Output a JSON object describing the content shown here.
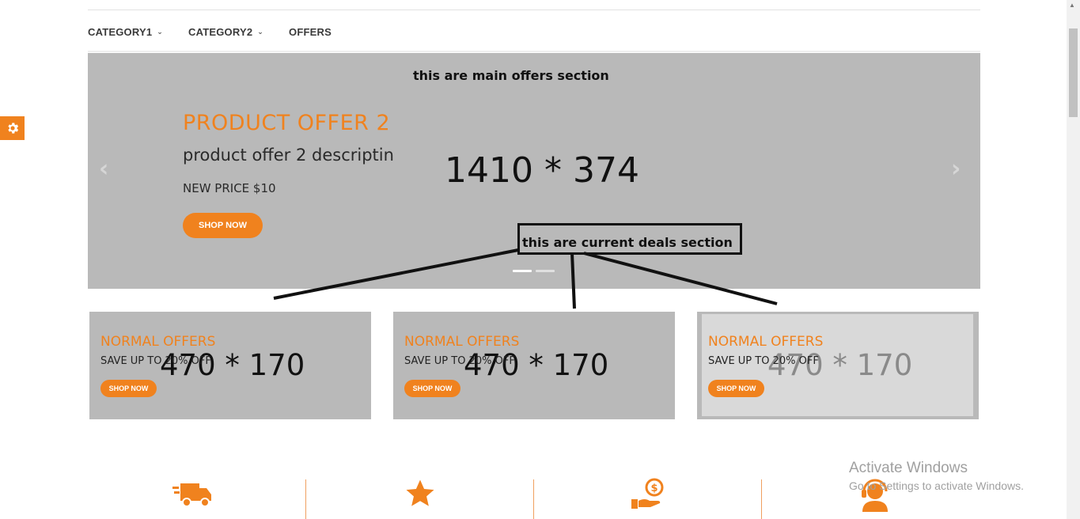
{
  "nav": {
    "items": [
      {
        "label": "CATEGORY1",
        "has_dropdown": true
      },
      {
        "label": "CATEGORY2",
        "has_dropdown": true
      },
      {
        "label": "OFFERS",
        "has_dropdown": false
      }
    ]
  },
  "hero": {
    "annotation": "this are main offers section",
    "title": "PRODUCT OFFER 2",
    "description": "product offer 2 descriptin",
    "price": "NEW PRICE $10",
    "button_label": "SHOP NOW",
    "dimension": "1410 * 374",
    "prev_arrow": "‹",
    "next_arrow": "›",
    "slides": 2,
    "active_slide": 1
  },
  "deals_annotation": "this are current deals section",
  "cards": [
    {
      "title": "NORMAL OFFERS",
      "subtitle": "SAVE UP TO 20% OFF",
      "button_label": "SHOP NOW",
      "dimension": "470 * 170"
    },
    {
      "title": "NORMAL OFFERS",
      "subtitle": "SAVE UP TO 20% OFF",
      "button_label": "SHOP NOW",
      "dimension": "470 * 170"
    },
    {
      "title": "NORMAL OFFERS",
      "subtitle": "SAVE UP TO 20% OFF",
      "button_label": "SHOP NOW",
      "dimension": "470 * 170"
    }
  ],
  "features": [
    {
      "icon": "delivery-truck-icon"
    },
    {
      "icon": "star-icon"
    },
    {
      "icon": "money-hand-icon"
    },
    {
      "icon": "customer-support-icon"
    }
  ],
  "windows_notice": {
    "title": "Activate Windows",
    "subtitle": "Go to Settings to activate Windows."
  },
  "colors": {
    "accent": "#f0821e",
    "hero_bg": "#b9b9b9",
    "card_highlight": "#d9d9d9"
  }
}
